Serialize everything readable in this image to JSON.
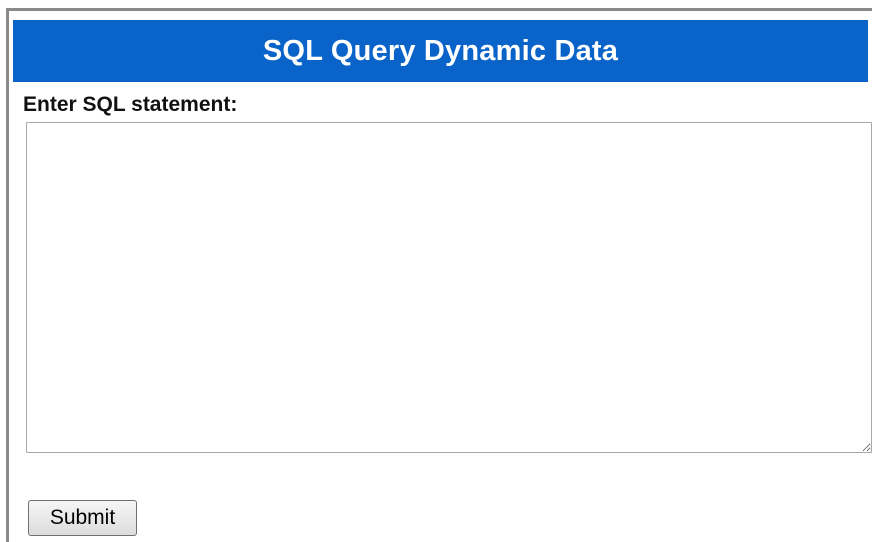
{
  "header": {
    "title": "SQL Query Dynamic Data"
  },
  "form": {
    "label": "Enter SQL statement:",
    "sql_value": "",
    "submit_label": "Submit"
  },
  "colors": {
    "header_bg": "#0a63c9",
    "header_text": "#ffffff",
    "frame_border": "#8a8a8a"
  }
}
